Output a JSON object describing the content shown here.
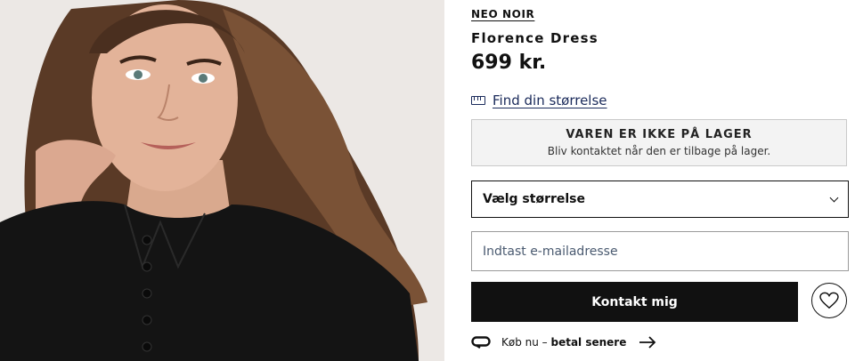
{
  "product": {
    "brand": "NEO NOIR",
    "title": "Florence Dress",
    "price": "699 kr.",
    "image_alt": "Model i sort kjole"
  },
  "size_guide": {
    "label": "Find din størrelse",
    "icon": "ruler-icon"
  },
  "stock_notice": {
    "heading": "VAREN ER IKKE PÅ LAGER",
    "message": "Bliv kontaktet når den er tilbage på lager."
  },
  "size_select": {
    "value": "Vælg størrelse",
    "icon": "chevron-down-icon"
  },
  "email_field": {
    "placeholder": "Indtast e-mailadresse",
    "value": ""
  },
  "contact_button": {
    "label": "Kontakt mig"
  },
  "wishlist": {
    "icon": "heart-icon"
  },
  "payment_promo": {
    "prefix": "Køb nu – ",
    "bold": "betal senere",
    "icons": [
      "klarna-icon",
      "arrow-right-icon"
    ]
  },
  "colors": {
    "accent": "#111111",
    "link": "#1a2a5a",
    "notice_bg": "#f3f3f3"
  }
}
